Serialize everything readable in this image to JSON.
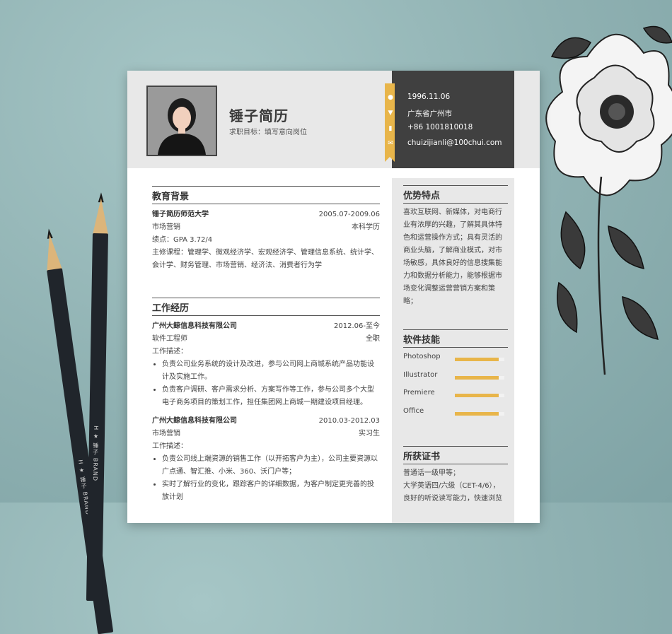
{
  "resume": {
    "name": "锤子简历",
    "objective": "求职目标：填写意向岗位",
    "contact": [
      {
        "icon": "user-icon",
        "text": "1996.11.06"
      },
      {
        "icon": "location-pin-icon",
        "text": "广东省广州市"
      },
      {
        "icon": "phone-icon",
        "text": "+86 1001810018"
      },
      {
        "icon": "mail-icon",
        "text": "chuizijianli@100chui.com"
      }
    ],
    "education": {
      "title": "教育背景",
      "school": "锤子简历师范大学",
      "period": "2005.07-2009.06",
      "major": "市场营销",
      "degree": "本科学历",
      "gpa": "绩点：GPA 3.72/4",
      "courses": "主修课程：管理学、微观经济学、宏观经济学、管理信息系统、统计学、会计学、财务管理、市场营销、经济法、消费者行为学"
    },
    "work": {
      "title": "工作经历",
      "jobs": [
        {
          "company": "广州大鲸信息科技有限公司",
          "period": "2012.06-至今",
          "role": "软件工程师",
          "type": "全职",
          "desc_label": "工作描述：",
          "bullets": [
            "负责公司业务系统的设计及改进，参与公司网上商城系统产品功能设计及实施工作。",
            "负责客户调研、客户需求分析、方案写作等工作，参与公司多个大型电子商务项目的策划工作，担任集团网上商城一期建设项目经理。"
          ]
        },
        {
          "company": "广州大鲸信息科技有限公司",
          "period": "2010.03-2012.03",
          "role": "市场营销",
          "type": "实习生",
          "desc_label": "工作描述：",
          "bullets": [
            "负责公司线上端资源的销售工作（以开拓客户为主），公司主要资源以广点通、智汇推、小米、360、沃门户等；",
            "实时了解行业的变化，跟踪客户的详细数据，为客户制定更完善的投放计划"
          ]
        }
      ]
    },
    "strengths": {
      "title": "优势特点",
      "text": "喜欢互联网、新媒体，对电商行业有浓厚的兴趣，了解其具体特色和运营操作方式；具有灵活的商业头脑，了解商业模式，对市场敏感，具体良好的信息搜集能力和数据分析能力，能够根据市场变化调整运营营销方案和策略；"
    },
    "skills": {
      "title": "软件技能",
      "items": [
        {
          "name": "Photoshop",
          "level": 0.88
        },
        {
          "name": "Illustrator",
          "level": 0.88
        },
        {
          "name": "Premiere",
          "level": 0.88
        },
        {
          "name": "Office",
          "level": 0.88
        }
      ]
    },
    "certificates": {
      "title": "所获证书",
      "lines": [
        "普通话一级甲等；",
        "大学英语四/六级（CET-4/6），",
        "良好的听说读写能力，快速浏览"
      ]
    }
  },
  "pencil_brand": "H ★ 锤子 BRAND",
  "colors": {
    "accent": "#e8b54a",
    "dark": "#404040",
    "panel": "#e8e8e8",
    "desk": "#8fb3b4"
  }
}
